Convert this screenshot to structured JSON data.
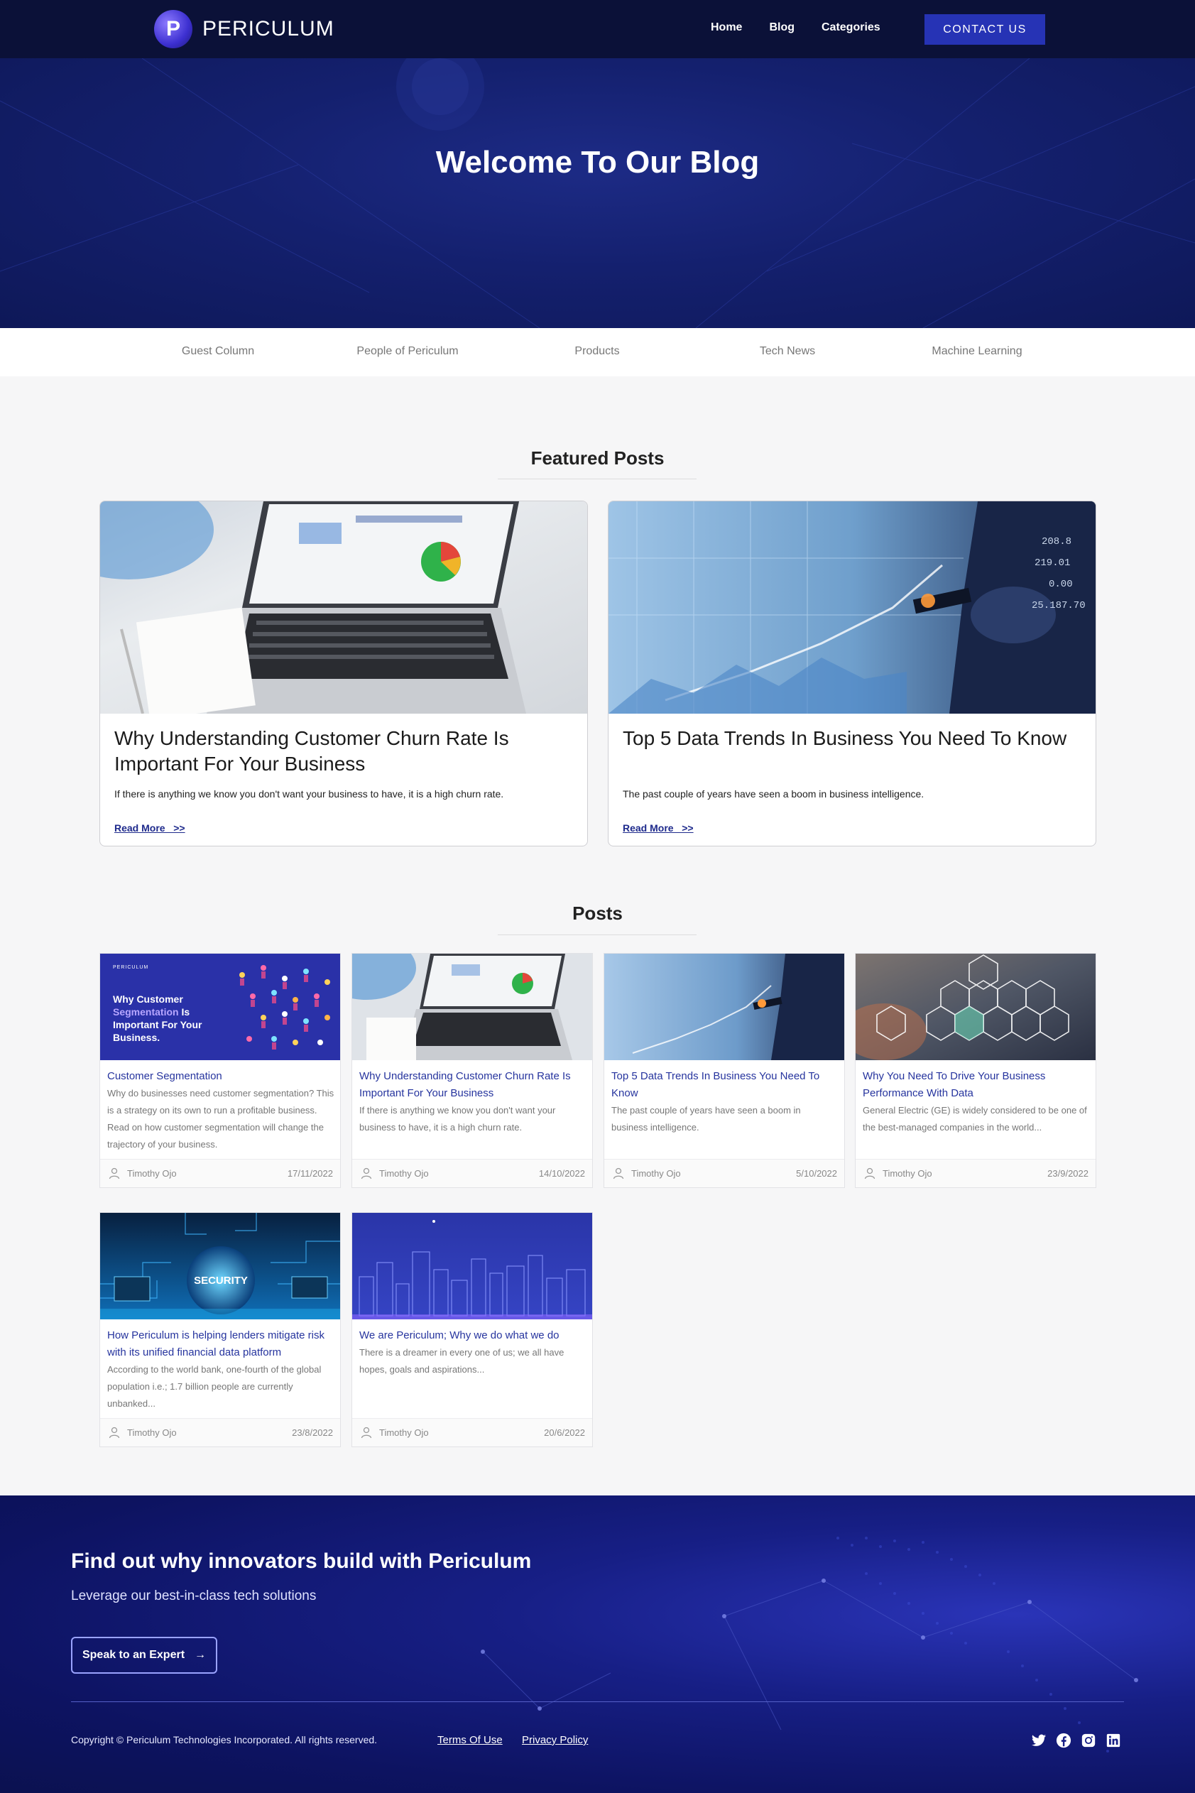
{
  "nav": {
    "brand": "PERICULUM",
    "brand_initial": "P",
    "links": [
      "Home",
      "Blog",
      "Categories"
    ],
    "contact_label": "CONTACT US"
  },
  "hero": {
    "title": "Welcome To Our Blog"
  },
  "categories": [
    "Guest Column",
    "People of Periculum",
    "Products",
    "Tech News",
    "Machine Learning"
  ],
  "featured": {
    "title": "Featured Posts",
    "posts": [
      {
        "title": "Why Understanding Customer Churn Rate Is Important For Your Business",
        "excerpt": "If there is anything we know you don't want your business to have, it is a high churn rate.",
        "read_more": "Read More   >>"
      },
      {
        "title": "Top 5 Data Trends In Business You Need To Know",
        "excerpt": "The past couple of years have seen a boom in business intelligence.",
        "read_more": "Read More   >>"
      }
    ]
  },
  "posts": {
    "title": "Posts",
    "items": [
      {
        "title": "Customer Segmentation",
        "excerpt": "Why do businesses need customer segmentation? This is a strategy on its own to run a profitable business. Read on how customer segmentation will change the trajectory of your business.",
        "author": "Timothy Ojo",
        "date": "17/11/2022",
        "thumb_brand": "PERICULUM",
        "thumb_line1": "Why Customer",
        "thumb_line2": "Segmentation",
        "thumb_line2b": " Is",
        "thumb_line3": "Important For Your",
        "thumb_line4": "Business."
      },
      {
        "title": "Why Understanding Customer Churn Rate Is Important For Your Business",
        "excerpt": "If there is anything we know you don't want your business to have, it is a high churn rate.",
        "author": "Timothy Ojo",
        "date": "14/10/2022"
      },
      {
        "title": "Top 5 Data Trends In Business You Need To Know",
        "excerpt": "The past couple of years have seen a boom in business intelligence.",
        "author": "Timothy Ojo",
        "date": "5/10/2022"
      },
      {
        "title": "Why You Need To Drive Your Business Performance With Data",
        "excerpt": "General Electric (GE) is widely considered to be one of the best-managed companies in the world...",
        "author": "Timothy Ojo",
        "date": "23/9/2022"
      },
      {
        "title": "How Periculum is helping lenders mitigate risk with its unified financial data platform",
        "excerpt": "According to the world bank, one-fourth of the global population i.e.; 1.7 billion people are currently unbanked...",
        "author": "Timothy Ojo",
        "date": "23/8/2022",
        "thumb_text": "SECURITY"
      },
      {
        "title": "We are Periculum; Why we do what we do",
        "excerpt": "There is a dreamer in every one of us; we all have hopes, goals and aspirations...",
        "author": "Timothy Ojo",
        "date": "20/6/2022"
      }
    ]
  },
  "footer": {
    "headline": "Find out why innovators build with Periculum",
    "subline": "Leverage our best-in-class tech solutions",
    "cta_label": "Speak to an Expert",
    "cta_arrow": "→",
    "copyright": "Copyright © Periculum Technologies Incorporated. All rights reserved.",
    "terms": "Terms Of Use",
    "privacy": "Privacy Policy",
    "socials": [
      "twitter-icon",
      "facebook-icon",
      "instagram-icon",
      "linkedin-icon"
    ]
  },
  "colors": {
    "nav_bg": "#0b1138",
    "accent": "#2633b5",
    "link_blue": "#26349e",
    "footer_bg": "#171f86"
  }
}
